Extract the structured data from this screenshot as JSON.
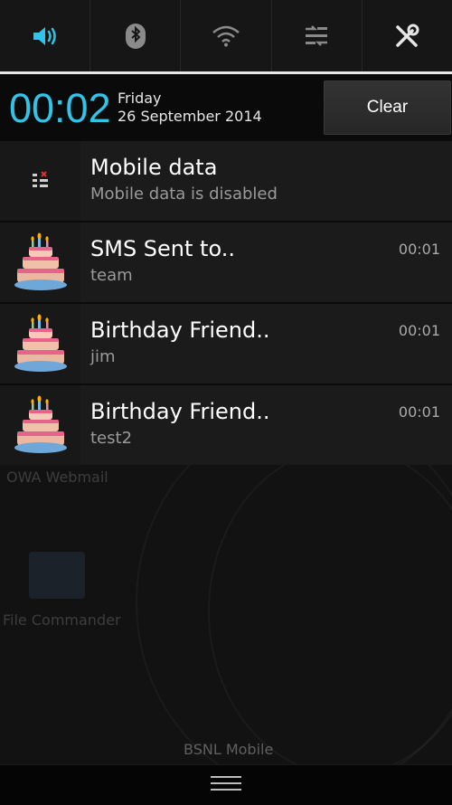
{
  "quick_settings": {
    "accent": "#31c3e8",
    "items": [
      {
        "name": "sound-icon",
        "active": true
      },
      {
        "name": "bluetooth-icon",
        "active": false
      },
      {
        "name": "wifi-icon",
        "active": false
      },
      {
        "name": "data-transfer-icon",
        "active": false
      },
      {
        "name": "settings-tools-icon",
        "active": false
      }
    ]
  },
  "header": {
    "time": "00:02",
    "day": "Friday",
    "date": "26 September 2014",
    "clear_label": "Clear"
  },
  "notifications": [
    {
      "icon": "mobile-data-icon",
      "title": "Mobile data",
      "subtitle": "Mobile data is disabled",
      "time": ""
    },
    {
      "icon": "birthday-cake-icon",
      "title": "SMS Sent to..",
      "subtitle": "team",
      "time": "00:01"
    },
    {
      "icon": "birthday-cake-icon",
      "title": "Birthday Friend..",
      "subtitle": "jim",
      "time": "00:01"
    },
    {
      "icon": "birthday-cake-icon",
      "title": "Birthday Friend..",
      "subtitle": "test2",
      "time": "00:01"
    }
  ],
  "background": {
    "owa_label": "OWA Webmail",
    "file_label": "File Commander",
    "carrier": "BSNL Mobile"
  },
  "handle": {
    "icon": "menu-handle-icon"
  }
}
